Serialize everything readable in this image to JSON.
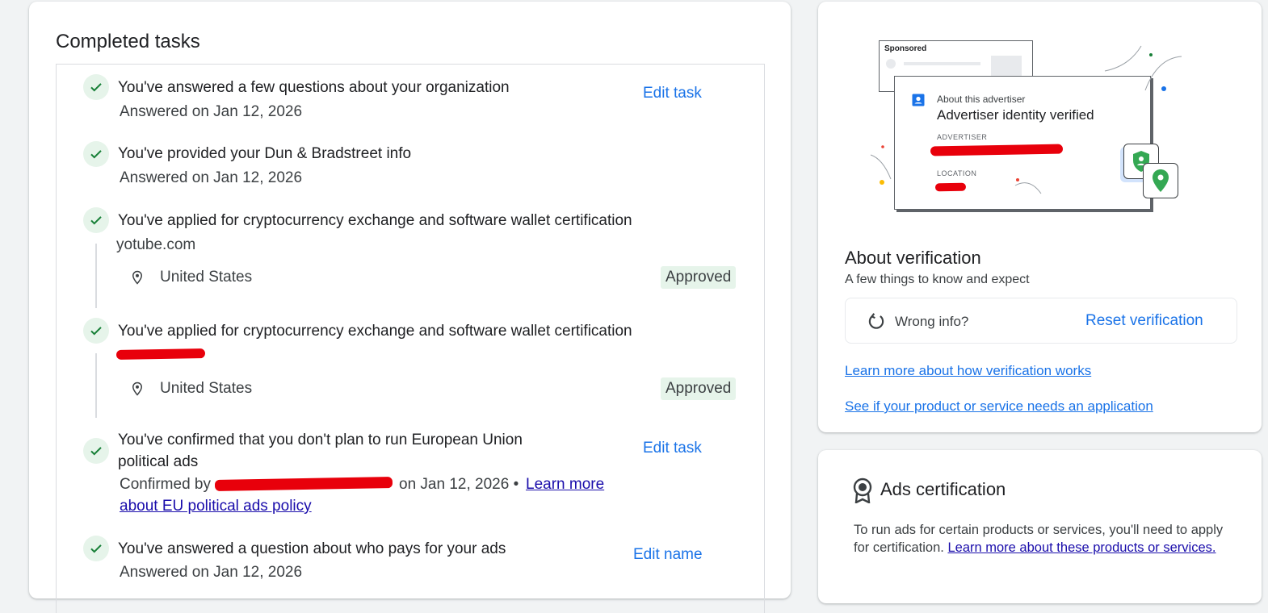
{
  "completed": {
    "title": "Completed tasks",
    "tasks": [
      {
        "title": "You've answered a few questions about your organization",
        "sub": "Answered on Jan 12, 2026",
        "action": "Edit task"
      },
      {
        "title": "You've provided your Dun & Bradstreet info",
        "sub": "Answered on Jan 12, 2026"
      },
      {
        "title": "You've applied for cryptocurrency exchange and software wallet certification",
        "domain": "yotube.com",
        "location": "United States",
        "status": "Approved"
      },
      {
        "title": "You've applied for cryptocurrency exchange and software wallet certification",
        "location": "United States",
        "status": "Approved"
      },
      {
        "title_line1": "You've confirmed that you don't plan to run European Union",
        "title_line2": "political ads",
        "confirmed_prefix": "Confirmed by",
        "confirmed_date": "on Jan 12, 2026 •",
        "link_line1": "Learn more",
        "link_line2": "about EU political ads policy",
        "action": "Edit task"
      },
      {
        "title": "You've answered a question about who pays for your ads",
        "sub": "Answered on Jan 12, 2026",
        "action": "Edit name"
      }
    ]
  },
  "illustration": {
    "sponsored": "Sponsored",
    "about_label": "About this advertiser",
    "verified_title": "Advertiser identity verified",
    "advertiser_label": "ADVERTISER",
    "location_label": "LOCATION"
  },
  "verification": {
    "title": "About verification",
    "subtitle": "A few things to know and expect",
    "wrong_info": "Wrong info?",
    "reset_button": "Reset verification",
    "link_how": "Learn more about how verification works",
    "link_product": "See if your product or service needs an application"
  },
  "certification": {
    "title": "Ads certification",
    "text": "To run ads for certain products or services, you'll need to apply for certification.",
    "link": "Learn more about these products or services."
  },
  "colors": {
    "accent": "#1a73e8",
    "check_green": "#188038",
    "badge_bg": "#e6f4ea"
  }
}
